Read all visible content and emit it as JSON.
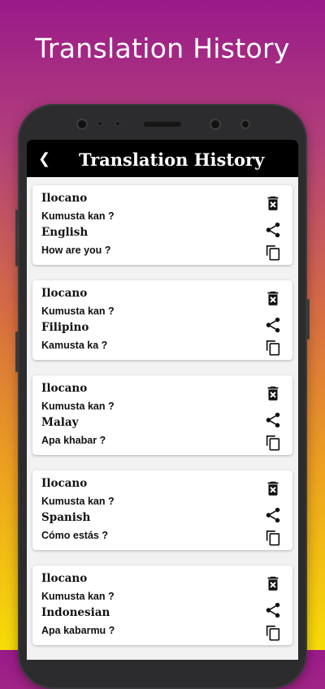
{
  "promo": {
    "title": "Translation History"
  },
  "appbar": {
    "back_icon": "back-arrow-icon",
    "title": "Translation History"
  },
  "history": [
    {
      "source_lang": "Ilocano",
      "source_text": "Kumusta kan ?",
      "target_lang": "English",
      "target_text": "How are you ?"
    },
    {
      "source_lang": "Ilocano",
      "source_text": "Kumusta kan ?",
      "target_lang": "Filipino",
      "target_text": "Kamusta ka ?"
    },
    {
      "source_lang": "Ilocano",
      "source_text": "Kumusta kan ?",
      "target_lang": "Malay",
      "target_text": "Apa khabar ?"
    },
    {
      "source_lang": "Ilocano",
      "source_text": "Kumusta kan ?",
      "target_lang": "Spanish",
      "target_text": "Cómo estás ?"
    },
    {
      "source_lang": "Ilocano",
      "source_text": "Kumusta kan ?",
      "target_lang": "Indonesian",
      "target_text": "Apa kabarmu ?"
    }
  ],
  "icons": {
    "delete": "delete-icon",
    "share": "share-icon",
    "copy": "copy-icon"
  },
  "colors": {
    "appbar": "#000000",
    "gradient_top": "#9a1a8a",
    "gradient_bottom": "#f7dc08"
  }
}
